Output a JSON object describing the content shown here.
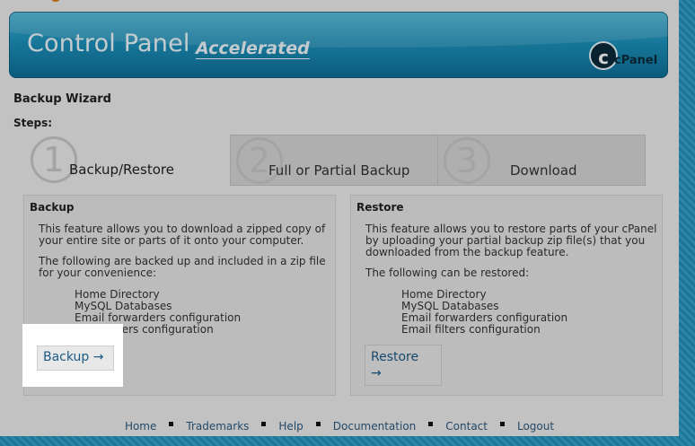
{
  "banner": {
    "title": "Control Panel",
    "subtitle": "Accelerated",
    "logo_text": "cPanel",
    "logo_mark": "c"
  },
  "page_title": "Backup Wizard",
  "steps_label": "Steps:",
  "tabs": [
    {
      "number": "1",
      "label": "Backup/Restore"
    },
    {
      "number": "2",
      "label": "Full or Partial Backup"
    },
    {
      "number": "3",
      "label": "Download"
    }
  ],
  "backup": {
    "title": "Backup",
    "desc1_line1": "This feature allows you to download a zipped copy of",
    "desc1_line2": "your entire site or parts of it onto your computer.",
    "desc2_line1": "The following are backed up and included in a zip file",
    "desc2_line2": "for your convenience:",
    "items": [
      "Home Directory",
      "MySQL Databases",
      "Email forwarders configuration",
      "Email filters configuration"
    ],
    "button_label": "Backup →"
  },
  "restore": {
    "title": "Restore",
    "desc1_line1": "This feature allows you to restore parts of your cPanel",
    "desc1_line2": "by uploading your partial backup zip file(s) that you",
    "desc1_line3": "downloaded from the backup feature.",
    "desc2": "The following can be restored:",
    "items": [
      "Home Directory",
      "MySQL Databases",
      "Email forwarders configuration",
      "Email filters configuration"
    ],
    "button_line1": "Restore",
    "button_line2": "→"
  },
  "footer": [
    "Home",
    "Trademarks",
    "Help",
    "Documentation",
    "Contact",
    "Logout"
  ]
}
